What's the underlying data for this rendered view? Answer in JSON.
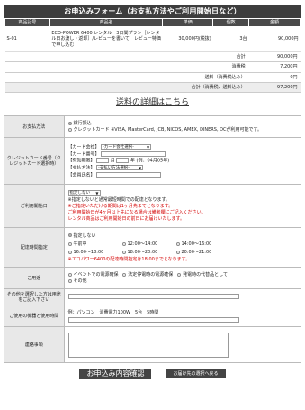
{
  "title": "お申込みフォーム（お支払方法やご利用開始日など）",
  "order": {
    "headers": [
      "商品記号",
      "商品名",
      "単価",
      "個数",
      "金額"
    ],
    "item": {
      "code": "S-01",
      "name": "ECO-POWER 6400 レンタル　3日間プラン［レンタル日お渡し・返却］/レビューを書いて　レビュー特価で申し込む",
      "price": "30,000円(税抜)",
      "qty": "3台",
      "amount": "90,000円"
    },
    "summary": [
      {
        "label": "合計",
        "value": "90,000円"
      },
      {
        "label": "消費税",
        "value": "7,200円"
      },
      {
        "label": "送料（消費税込み）",
        "value": "0円"
      },
      {
        "label": "合計（消費税、送料込み）",
        "value": "97,200円"
      }
    ]
  },
  "shipping_link": "送料の詳細はこちら",
  "payment": {
    "label": "お支払方法",
    "option1": "銀行振込",
    "option2": "クレジットカード",
    "option2_note": "※VISA, MasterCard, JCB, NICOS, AMEX, DINERS, DCが利用可能です。"
  },
  "card": {
    "label": "クレジットカード番号（クレジットカード選択時）",
    "company_label": "【カード会社】",
    "company_select": "-カード会社選択-",
    "number_label": "【カード番号】",
    "expiry_label": "【有効期限】",
    "month_unit": "月",
    "year_unit": "年",
    "expiry_example": "(例：04月05年)",
    "method_label": "【支払方法】",
    "method_select": "-支払い方法選択-",
    "name_label": "【会員氏名】"
  },
  "start_date": {
    "label": "ご利用開始日",
    "select": "指定しない",
    "note1": "※指定しないと通常最短時間での配達となります。",
    "note2": "※ご指定いただける期間は1ヶ月先までとなります。",
    "note3": "ご利用開始日が4ヶ月以上先になる場合は備考欄にご記入ください。",
    "note4": "レンタル商品はご利用開始日の前日にお届けいたします。"
  },
  "delivery_time": {
    "label": "配達時間指定",
    "options": [
      "指定しない",
      "午前中",
      "12:00〜14:00",
      "14:00〜16:00",
      "16:00〜18:00",
      "18:00〜20:00",
      "20:00〜21:00"
    ],
    "note": "※エコパワー6400の配達時間指定は18:00までとなります。"
  },
  "purpose": {
    "label": "ご用途",
    "options": [
      "イベントでの電源確保",
      "法定停電時の電源確保",
      "発電時の代替品として",
      "その他"
    ]
  },
  "other_purpose": {
    "label": "その他を選択した方は用途をご記入下さい"
  },
  "equipment": {
    "label": "ご使用の機器と使用時間",
    "example": "例：パソコン　消費電力100W　5台　5時間"
  },
  "remarks": {
    "label": "連絡事項"
  },
  "buttons": {
    "confirm": "お申込み内容確認",
    "back": "お届け先の選択へ戻る"
  }
}
